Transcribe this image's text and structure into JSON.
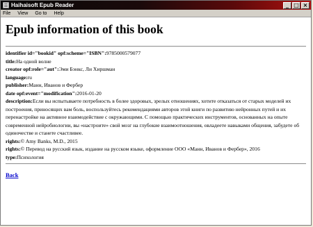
{
  "window": {
    "title": "Haihaisoft Epub Reader",
    "buttons": {
      "minimize": "_",
      "maximize": "□",
      "close": "×"
    }
  },
  "menu": [
    "File",
    "View",
    "Go to",
    "Help"
  ],
  "heading": "Epub information of this book",
  "metadata": [
    {
      "key": "identifier id=\"bookid\" opf:scheme=\"ISBN\":",
      "value": "9785000579077"
    },
    {
      "key": "title:",
      "value": "На одной волне"
    },
    {
      "key": "creator opf:role=\"aut\":",
      "value": "Эми Бэнкс, Ли Хиршман"
    },
    {
      "key": "language:",
      "value": "ru"
    },
    {
      "key": "publisher:",
      "value": "Манн, Иванов и Фербер"
    },
    {
      "key": "date opf:event=\"modification\":",
      "value": "2016-01-20"
    },
    {
      "key": "description:",
      "value": "Если вы испытываете потребность в более здоровых, зрелых отношениях, хотите отказаться от старых моделей их построения, приносящих вам боль, воспользуйтесь рекомендациями авторов этой книги по развитию нейронных путей и их перенастройке на активное взаимодействие с окружающими. С помощью практических инструментов, основанных на опыте современной нейробиологии, вы «настроите» свой мозг на глубокие взаимоотношения, овладеете навыками общения, забудете об одиночестве и станете счастливее."
    },
    {
      "key": "rights:",
      "value": "© Amy Banks, M.D., 2015"
    },
    {
      "key": "rights:",
      "value": "© Перевод на русский язык, издание на русском языке, оформление ООО «Манн, Иванов и Фербер», 2016"
    },
    {
      "key": "type:",
      "value": "Психология"
    }
  ],
  "back_link": "Back"
}
